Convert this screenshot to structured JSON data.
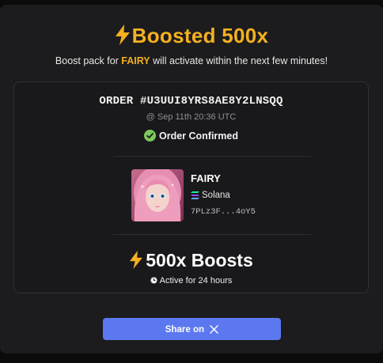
{
  "header": {
    "title": "Boosted 500x",
    "subtitle_prefix": "Boost pack for ",
    "subtitle_token": "FAIRY",
    "subtitle_suffix": " will activate within the next few minutes!"
  },
  "order": {
    "id_text": "ORDER #U3UUI8YRS8AE8Y2LNSQQ",
    "time_text": "@ Sep 11th 20:36 UTC",
    "status": "Order Confirmed"
  },
  "token": {
    "name": "FAIRY",
    "chain": "Solana",
    "address": "7PLz3F...4oY5"
  },
  "boost": {
    "label": "500x Boosts",
    "active_text": "Active for 24 hours"
  },
  "share": {
    "label": "Share on"
  },
  "colors": {
    "accent": "#f5b021",
    "share_button": "#5b78f0",
    "confirmed": "#7cc95a"
  },
  "icons": [
    "lightning-bolt-icon",
    "check-circle-icon",
    "solana-icon",
    "clock-icon",
    "x-logo-icon"
  ]
}
